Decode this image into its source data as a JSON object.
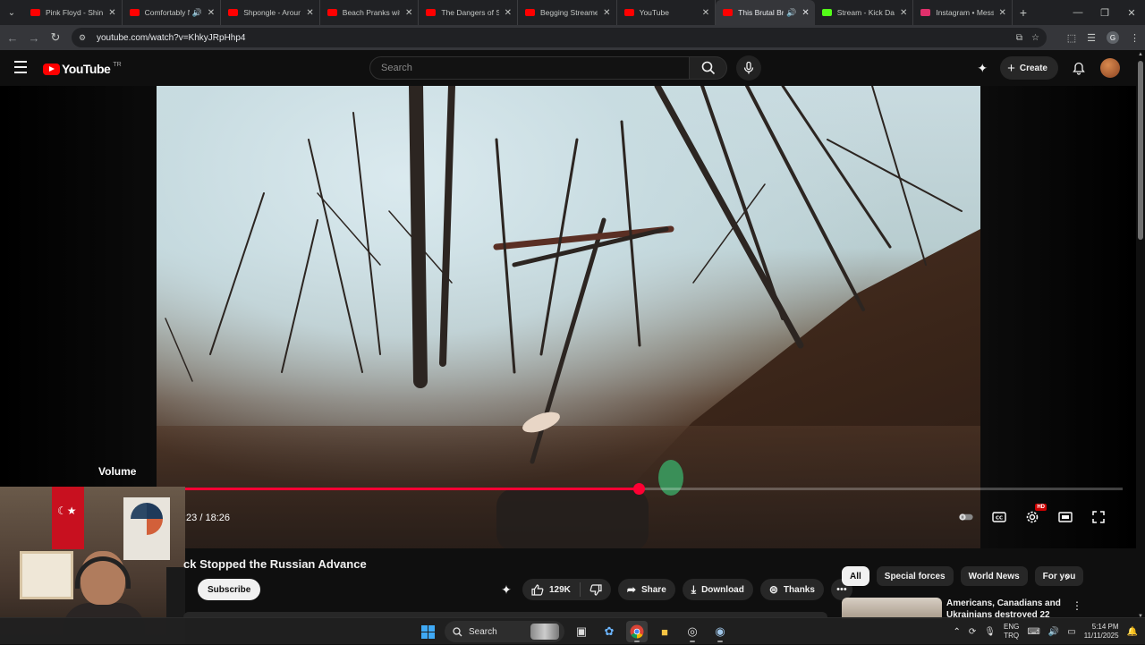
{
  "browser": {
    "tabs": [
      {
        "title": "Pink Floyd - Shine",
        "favicon_color": "#ff0000",
        "audio": false,
        "active": false
      },
      {
        "title": "Comfortably N",
        "favicon_color": "#ff0000",
        "audio": true,
        "active": false
      },
      {
        "title": "Shpongle - Around",
        "favicon_color": "#ff0000",
        "audio": false,
        "active": false
      },
      {
        "title": "Beach Pranks with",
        "favicon_color": "#ff0000",
        "audio": false,
        "active": false
      },
      {
        "title": "The Dangers of S",
        "favicon_color": "#ff0000",
        "audio": false,
        "active": false
      },
      {
        "title": "Begging Streamer",
        "favicon_color": "#ff0000",
        "audio": false,
        "active": false
      },
      {
        "title": "YouTube",
        "favicon_color": "#ff0000",
        "audio": false,
        "active": false
      },
      {
        "title": "This Brutal Br",
        "favicon_color": "#ff0000",
        "audio": true,
        "active": true
      },
      {
        "title": "Stream - Kick Das",
        "favicon_color": "#53fc18",
        "audio": false,
        "active": false
      },
      {
        "title": "Instagram • Mess",
        "favicon_color": "#e1306c",
        "audio": false,
        "active": false
      }
    ],
    "new_tab_glyph": "+",
    "url": "youtube.com/watch?v=KhkyJRpHhp4",
    "profile_initial": "G"
  },
  "youtube": {
    "logo_text": "YouTube",
    "country_code": "TR",
    "search_placeholder": "Search",
    "create_label": "Create"
  },
  "player": {
    "volume_tooltip": "Volume",
    "time_display": ":23 / 18:26",
    "progress_fraction": 0.485,
    "hd_badge": "HD"
  },
  "video": {
    "title_visible": "ck Stopped the Russian Advance",
    "subscribe_label": "Subscribe",
    "like_count": "129K",
    "share_label": "Share",
    "download_label": "Download",
    "thanks_label": "Thanks"
  },
  "sidebar": {
    "chips": [
      "All",
      "Special forces",
      "World News",
      "For you"
    ],
    "selected_chip": "All",
    "rec_title": "Americans, Canadians and Ukrainians destroyed 22"
  },
  "taskbar": {
    "search_label": "Search",
    "lang_top": "ENG",
    "lang_bottom": "TRQ",
    "time": "5:14 PM",
    "date": "11/11/2025"
  },
  "colors": {
    "accent_red": "#ff0033",
    "youtube_red": "#ff0000",
    "background": "#0f0f0f"
  }
}
